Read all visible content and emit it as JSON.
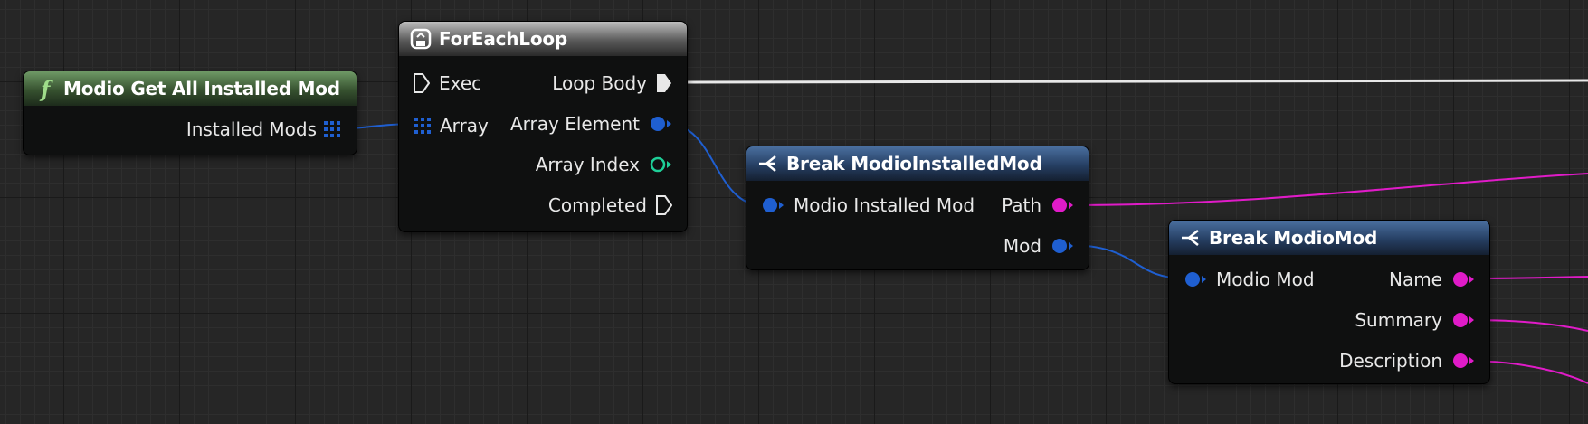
{
  "colors": {
    "exec_wire": "#e8e8e8",
    "struct_wire": "#1f5fd1",
    "string_wire": "#e01bc8",
    "int_pin": "#1ecf98",
    "function_header": "#5a8a50",
    "macro_header": "#8a8a8a",
    "break_header": "#2f4f7f"
  },
  "nodes": {
    "get_installed": {
      "title": "Modio Get All Installed Mod",
      "icon": "function-icon",
      "outputs": [
        "Installed Mods"
      ]
    },
    "for_each": {
      "title": "ForEachLoop",
      "icon": "loop-icon",
      "inputs": [
        "Exec",
        "Array"
      ],
      "outputs": [
        "Loop Body",
        "Array Element",
        "Array Index",
        "Completed"
      ]
    },
    "break_installed": {
      "title": "Break ModioInstalledMod",
      "icon": "break-struct-icon",
      "inputs": [
        "Modio Installed Mod"
      ],
      "outputs": [
        "Path",
        "Mod"
      ]
    },
    "break_mod": {
      "title": "Break ModioMod",
      "icon": "break-struct-icon",
      "inputs": [
        "Modio Mod"
      ],
      "outputs": [
        "Name",
        "Summary",
        "Description"
      ]
    }
  }
}
